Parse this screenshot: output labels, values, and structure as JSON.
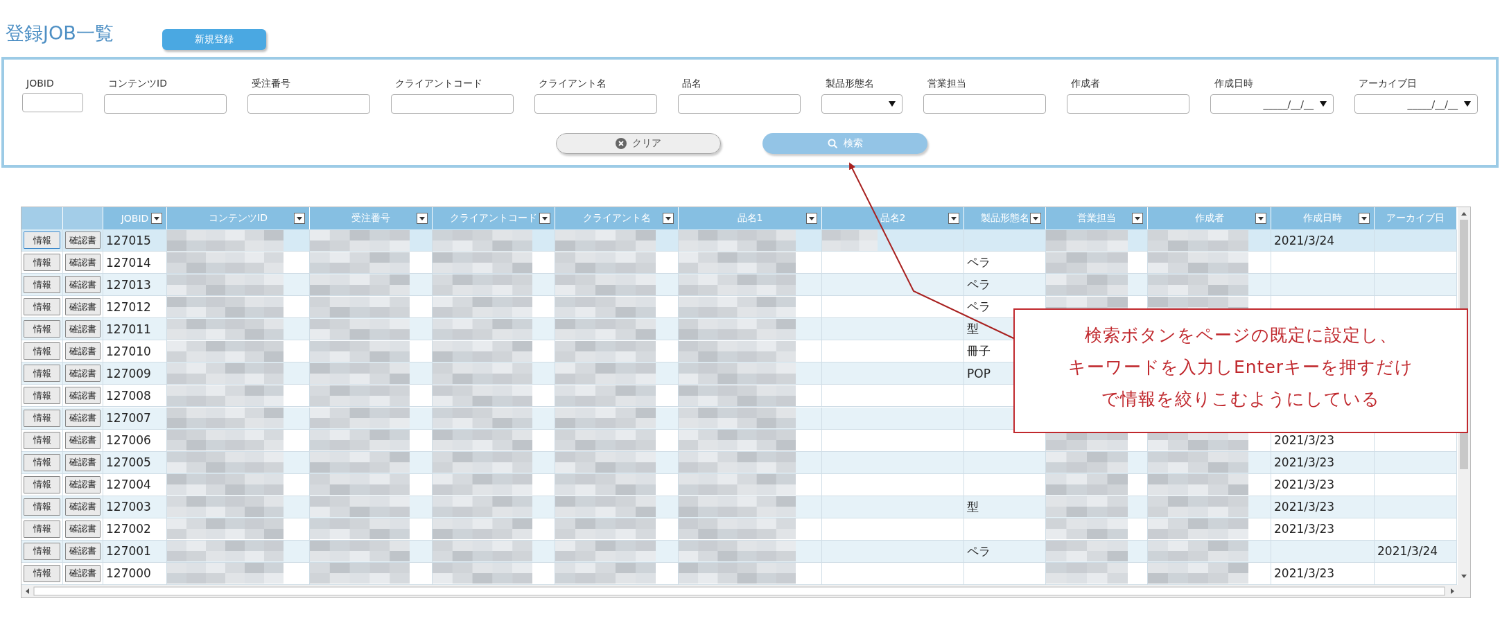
{
  "page": {
    "title": "登録JOB一覧",
    "new_button": "新規登録"
  },
  "search": {
    "fields": [
      {
        "label": "JOBID",
        "kind": "short"
      },
      {
        "label": "コンテンツID",
        "kind": "text"
      },
      {
        "label": "受注番号",
        "kind": "text"
      },
      {
        "label": "クライアントコード",
        "kind": "text"
      },
      {
        "label": "クライアント名",
        "kind": "text"
      },
      {
        "label": "品名",
        "kind": "text"
      },
      {
        "label": "製品形態名",
        "kind": "select"
      },
      {
        "label": "営業担当",
        "kind": "text"
      },
      {
        "label": "作成者",
        "kind": "text"
      },
      {
        "label": "作成日時",
        "kind": "date",
        "value": "_____/__/__"
      },
      {
        "label": "アーカイブ日",
        "kind": "date",
        "value": "_____/__/__"
      }
    ],
    "clear_button": "クリア",
    "search_button": "検索"
  },
  "table": {
    "columns": [
      {
        "kind": "action",
        "filter": false
      },
      {
        "kind": "action",
        "filter": false
      },
      {
        "label": "JOBID",
        "kind": "id",
        "filter": true
      },
      {
        "label": "コンテンツID",
        "kind": "masked",
        "filter": true
      },
      {
        "label": "受注番号",
        "kind": "masked",
        "filter": true
      },
      {
        "label": "クライアントコード",
        "kind": "masked",
        "filter": true
      },
      {
        "label": "クライアント名",
        "kind": "masked",
        "filter": true
      },
      {
        "label": "品名1",
        "kind": "masked",
        "filter": true
      },
      {
        "label": "品名2",
        "kind": "item2",
        "filter": true
      },
      {
        "label": "製品形態名",
        "kind": "form",
        "filter": true
      },
      {
        "label": "営業担当",
        "kind": "masked",
        "filter": true
      },
      {
        "label": "作成者",
        "kind": "masked",
        "filter": true
      },
      {
        "label": "作成日時",
        "kind": "created",
        "filter": true
      },
      {
        "label": "アーカイブ日",
        "kind": "archived",
        "filter": false
      }
    ],
    "rows": [
      {
        "buttons": [
          "情報",
          "確認書"
        ],
        "jobid": "127015",
        "selected": true,
        "item2_masked": true,
        "created": "2021/3/24"
      },
      {
        "buttons": [
          "情報",
          "確認書"
        ],
        "jobid": "127014",
        "selected": false,
        "form": "ペラ"
      },
      {
        "buttons": [
          "情報",
          "確認書"
        ],
        "jobid": "127013",
        "selected": false,
        "form": "ペラ"
      },
      {
        "buttons": [
          "情報",
          "確認書"
        ],
        "jobid": "127012",
        "selected": false,
        "form": "ペラ"
      },
      {
        "buttons": [
          "情報",
          "確認書"
        ],
        "jobid": "127011",
        "selected": false,
        "form": "型"
      },
      {
        "buttons": [
          "情報",
          "確認書"
        ],
        "jobid": "127010",
        "selected": false,
        "form": "冊子"
      },
      {
        "buttons": [
          "情報",
          "確認書"
        ],
        "jobid": "127009",
        "selected": false,
        "form": "POP"
      },
      {
        "buttons": [
          "情報",
          "確認書"
        ],
        "jobid": "127008",
        "selected": false
      },
      {
        "buttons": [
          "情報",
          "確認書"
        ],
        "jobid": "127007",
        "selected": false
      },
      {
        "buttons": [
          "情報",
          "確認書"
        ],
        "jobid": "127006",
        "selected": false,
        "created": "2021/3/23"
      },
      {
        "buttons": [
          "情報",
          "確認書"
        ],
        "jobid": "127005",
        "selected": false,
        "created": "2021/3/23"
      },
      {
        "buttons": [
          "情報",
          "確認書"
        ],
        "jobid": "127004",
        "selected": false,
        "created": "2021/3/23"
      },
      {
        "buttons": [
          "情報",
          "確認書"
        ],
        "jobid": "127003",
        "selected": false,
        "form": "型",
        "created": "2021/3/23"
      },
      {
        "buttons": [
          "情報",
          "確認書"
        ],
        "jobid": "127002",
        "selected": false,
        "created": "2021/3/23"
      },
      {
        "buttons": [
          "情報",
          "確認書"
        ],
        "jobid": "127001",
        "selected": false,
        "form": "ペラ",
        "archived": "2021/3/24"
      },
      {
        "buttons": [
          "情報",
          "確認書"
        ],
        "jobid": "127000",
        "selected": false,
        "created": "2021/3/23"
      }
    ]
  },
  "callout": {
    "lines": [
      "検索ボタンをページの既定に設定し、",
      "キーワードを入力しEnterキーを押すだけ",
      "で情報を絞りこむようにしている"
    ]
  }
}
